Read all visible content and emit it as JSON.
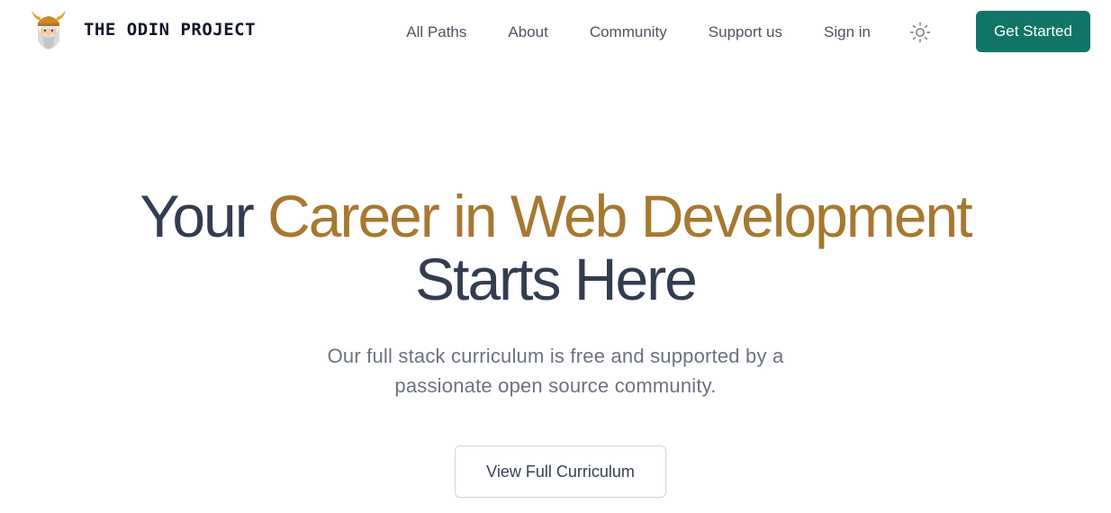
{
  "header": {
    "logo": {
      "text": "THE ODIN PROJECT",
      "icon": "viking-helmet-logo-icon"
    },
    "nav": {
      "all_paths": "All Paths",
      "about": "About",
      "community": "Community",
      "support_us": "Support us",
      "sign_in": "Sign in"
    },
    "theme_toggle": {
      "icon": "sun-icon"
    },
    "cta": {
      "label": "Get Started"
    }
  },
  "hero": {
    "title_part1": "Your ",
    "title_accent": "Career in Web Development",
    "title_part2": "Starts Here",
    "subtitle": "Our full stack curriculum is free and supported by a passionate open source community.",
    "button_label": "View Full Curriculum"
  },
  "colors": {
    "brand_gold": "#a67830",
    "heading": "#333d4f",
    "primary_button": "#107567",
    "muted_text": "#6b7280"
  }
}
